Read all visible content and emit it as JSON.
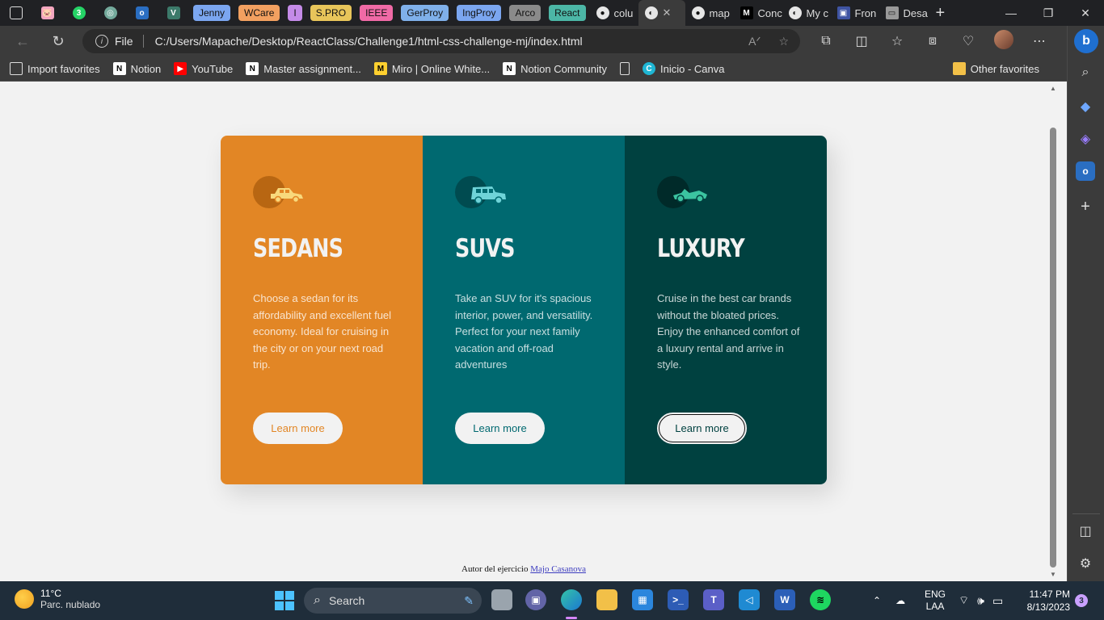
{
  "browser": {
    "tab_groups": [
      "Jenny",
      "WCare",
      "I",
      "S.PRO",
      "IEEE",
      "GerProy",
      "IngProy",
      "Arco",
      "React"
    ],
    "tab_group_colors": [
      "#7ba6f0",
      "#f2a060",
      "#c48be8",
      "#e8c55a",
      "#f06aa6",
      "#7fb0ea",
      "#7ba6f0",
      "#8a8a8a",
      "#4cb6a6"
    ],
    "tabs": [
      "colu",
      "",
      "map",
      "Conc",
      "My c",
      "Fron",
      "Desa"
    ],
    "new_tab_label": "+",
    "window_buttons": [
      "—",
      "❐",
      "✕"
    ],
    "address": {
      "scheme_label": "File",
      "url": "C:/Users/Mapache/Desktop/ReactClass/Challenge1/html-css-challenge-mj/index.html"
    },
    "bookmarks": [
      "Import favorites",
      "Notion",
      "YouTube",
      "Master assignment...",
      "Miro | Online White...",
      "Notion Community",
      "",
      "Inicio - Canva"
    ],
    "other_favorites": "Other favorites"
  },
  "page": {
    "cards": [
      {
        "title": "SEDANS",
        "text": "Choose a sedan for its affordability and excellent fuel economy. Ideal for cruising in the city or on your next road trip.",
        "button": "Learn more",
        "color": "#e28625",
        "icon": "sedan-icon"
      },
      {
        "title": "SUVS",
        "text": "Take an SUV for it's spacious interior, power, and versatility. Perfect for your next family vacation and off-road adventures",
        "button": "Learn more",
        "color": "#006970",
        "icon": "suv-icon"
      },
      {
        "title": "LUXURY",
        "text": "Cruise in the best car brands without the bloated prices. Enjoy the enhanced comfort of a luxury rental and arrive in style.",
        "button": "Learn more",
        "color": "#004140",
        "icon": "luxury-car-icon"
      }
    ],
    "credit_prefix": "Autor del ejercicio",
    "credit_author": "Majo Casanova"
  },
  "taskbar": {
    "weather_temp": "11°C",
    "weather_desc": "Parc. nublado",
    "search_label": "Search",
    "lang_1": "ENG",
    "lang_2": "LAA",
    "time": "11:47 PM",
    "date": "8/13/2023",
    "notifications": "3"
  }
}
